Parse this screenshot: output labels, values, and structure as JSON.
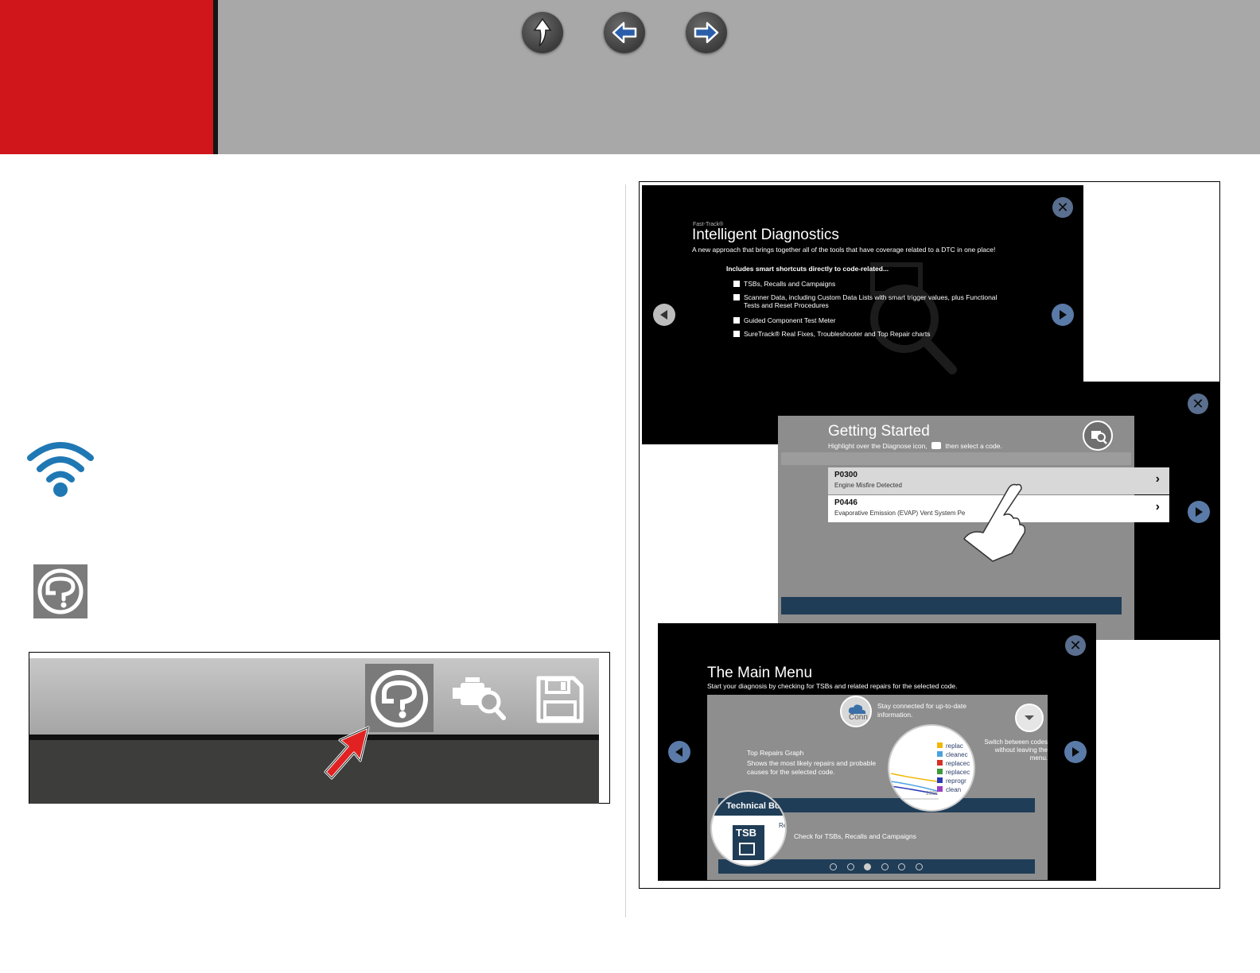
{
  "header": {
    "accent_color": "#d0161a",
    "bar_color": "#a8a8a8",
    "nav": [
      {
        "name": "up-arrow-icon"
      },
      {
        "name": "back-arrow-icon"
      },
      {
        "name": "forward-arrow-icon"
      }
    ]
  },
  "icons": {
    "wifi": "wifi-icon",
    "help": "help-icon",
    "wifi_color": "#1f78b4"
  },
  "toolbar": {
    "icons": [
      "help-icon",
      "engine-diagnose-icon",
      "save-icon",
      "red-pointer-arrow"
    ]
  },
  "screen1": {
    "brand": "Fast-Track®",
    "title": "Intelligent Diagnostics",
    "subtitle": "A new approach that brings together all of the tools that have coverage related to a DTC in one place!",
    "lead": "Includes smart shortcuts directly to code-related...",
    "items": [
      "TSBs, Recalls and Campaigns",
      "Scanner Data, including Custom Data Lists with smart trigger values, plus Functional Tests and Reset Procedures",
      "Guided Component Test Meter",
      "SureTrack® Real Fixes, Troubleshooter and Top Repair charts"
    ]
  },
  "screen2": {
    "title": "Getting Started",
    "subtitle_pre": "Highlight over the Diagnose icon,",
    "subtitle_post": "then select a code.",
    "codes": [
      {
        "code": "P0300",
        "desc": "Engine Misfire Detected"
      },
      {
        "code": "P0446",
        "desc": "Evaporative Emission (EVAP) Vent System Pe"
      }
    ]
  },
  "screen3": {
    "title": "The Main Menu",
    "subtitle": "Start your diagnosis by checking for TSBs and related repairs for the selected code.",
    "callout_connect": "Stay connected for up-to-date information.",
    "conn_label": "Conn",
    "callout_switch": "Switch between codes without leaving the menu.",
    "callout_graph_title": "Top Repairs Graph",
    "callout_graph_desc": "Shows the most likely repairs and probable causes for the selected code.",
    "chart_legend": [
      "replac",
      "cleanec",
      "replacec",
      "replacec",
      "reprogr",
      "clean"
    ],
    "chart_legend_colors": [
      "#f2b705",
      "#4aa3df",
      "#d93025",
      "#3c9a3c",
      "#2c3cb8",
      "#9b3fc4"
    ],
    "chart_tick": "200k",
    "tsb_header": "Technical Bu",
    "tsb_label": "TSB",
    "tsb_side": "Re",
    "callout_tsb": "Check for TSBs, Recalls and Campaigns",
    "pagination": {
      "count": 6,
      "active": 3
    }
  }
}
